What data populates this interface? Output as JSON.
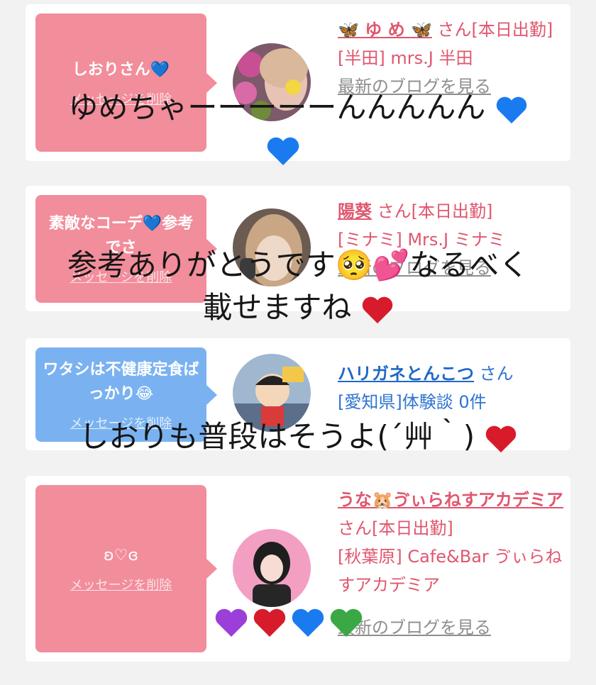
{
  "cards": [
    {
      "message": "しおりさん💙",
      "delete_label": "メッセージを削除",
      "user_name": "🦋 ゆ め 🦋",
      "honorific": "さん[本日出勤]",
      "shop": "[半田] mrs.J 半田",
      "blog_link": "最新のブログを見る",
      "bubble_color": "#f28d9b"
    },
    {
      "message": "素敵なコーデ💙参考でさ",
      "delete_label": "メッセージを削除",
      "user_name": "陽葵",
      "honorific": "さん[本日出勤]",
      "shop": "[ミナミ] Mrs.J ミナミ",
      "blog_link": "最新のブログを見る",
      "bubble_color": "#f28d9b"
    },
    {
      "message": "ワタシは不健康定食ばっかり😂",
      "delete_label": "メッセージを削除",
      "user_name": "ハリガネとんこつ",
      "honorific": "さん",
      "shop": "[愛知県]体験談 0件",
      "bubble_color": "#7ab2f1"
    },
    {
      "message": "ʚ♡ɞ",
      "delete_label": "メッセージを削除",
      "user_name": "うな🐹ゔぃらねすアカデミア",
      "honorific": "さん[本日出勤]",
      "shop": "[秋葉原] Cafe&Bar ゔぃらねすアカデミア",
      "blog_link": "最新のブログを見る",
      "bubble_color": "#f28d9b"
    }
  ],
  "overlays": {
    "caption1": "ゆめちゃーーーーーんんんんん",
    "caption2_line1": "参考ありがとうです🥺💕なるべく",
    "caption2_line2": "載せますね",
    "caption3": "しおりも普段はそうよ(´艸｀)"
  },
  "colors": {
    "pink_text": "#e0566e",
    "blue_text": "#1f67c7",
    "heart_red": "#d81b2a",
    "heart_blue": "#1a7bf0",
    "heart_purple": "#9b3fd8",
    "heart_green": "#3aa845"
  }
}
